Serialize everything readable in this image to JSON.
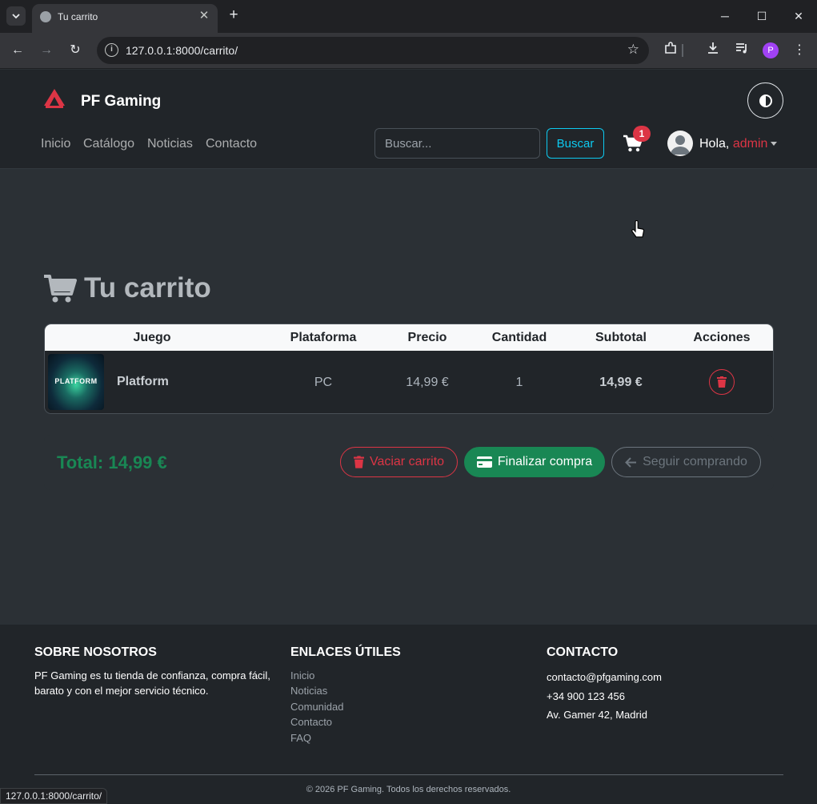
{
  "browser": {
    "tab_title": "Tu carrito",
    "url": "127.0.0.1:8000/carrito/",
    "profile_initial": "P",
    "status_url": "127.0.0.1:8000/carrito/"
  },
  "header": {
    "brand": "PF Gaming",
    "nav": [
      "Inicio",
      "Catálogo",
      "Noticias",
      "Contacto"
    ],
    "search_placeholder": "Buscar...",
    "search_button": "Buscar",
    "cart_count": "1",
    "greeting": "Hola,",
    "username": "admin"
  },
  "cart": {
    "title": "Tu carrito",
    "columns": [
      "Juego",
      "Plataforma",
      "Precio",
      "Cantidad",
      "Subtotal",
      "Acciones"
    ],
    "items": [
      {
        "name": "Platform",
        "thumb_text": "PLATFORM",
        "platform": "PC",
        "price": "14,99 €",
        "quantity": "1",
        "subtotal": "14,99 €"
      }
    ],
    "total": "Total: 14,99 €",
    "empty_button": "Vaciar carrito",
    "checkout_button": "Finalizar compra",
    "continue_button": "Seguir comprando"
  },
  "footer": {
    "about_heading": "SOBRE NOSOTROS",
    "about_text": "PF Gaming es tu tienda de confianza, compra fácil, barato y con el mejor servicio técnico.",
    "links_heading": "ENLACES ÚTILES",
    "links": [
      "Inicio",
      "Noticias",
      "Comunidad",
      "Contacto",
      "FAQ"
    ],
    "contact_heading": "CONTACTO",
    "contact_email": "contacto@pfgaming.com",
    "contact_phone": "+34 900 123 456",
    "contact_address": "Av. Gamer 42, Madrid",
    "copyright": "© 2026 PF Gaming. Todos los derechos reservados."
  },
  "colors": {
    "danger": "#dc3545",
    "success": "#198754",
    "info": "#0dcaf0",
    "secondary": "#6c757d",
    "dark_bg": "#212529",
    "body_bg": "#2b3035"
  },
  "icons": [
    "chevron-down-icon",
    "globe-icon",
    "close-icon",
    "plus-icon",
    "minimize-icon",
    "maximize-icon",
    "back-icon",
    "forward-icon",
    "reload-icon",
    "info-icon",
    "star-icon",
    "extensions-icon",
    "download-icon",
    "media-icon",
    "menu-icon",
    "logo-icon",
    "contrast-icon",
    "cart-icon",
    "user-icon",
    "trash-icon",
    "credit-card-icon",
    "arrow-left-icon",
    "cursor-icon"
  ]
}
